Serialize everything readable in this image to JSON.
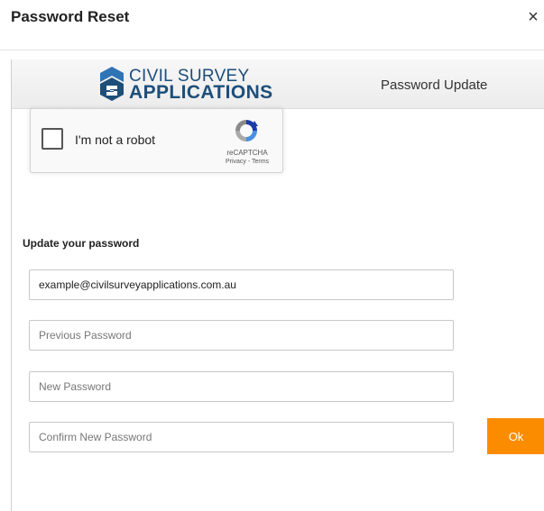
{
  "dialog": {
    "title": "Password Reset",
    "close_label": "×"
  },
  "banner": {
    "logo_line1": "CIVIL SURVEY",
    "logo_line2": "APPLICATIONS",
    "title": "Password Update"
  },
  "recaptcha": {
    "label": "I'm not a robot",
    "brand": "reCAPTCHA",
    "links": "Privacy - Terms",
    "checked": false
  },
  "form": {
    "heading": "Update your password",
    "email_value": "example@civilsurveyapplications.com.au",
    "previous_password_placeholder": "Previous Password",
    "new_password_placeholder": "New Password",
    "confirm_password_placeholder": "Confirm New Password",
    "ok_label": "Ok"
  },
  "colors": {
    "accent_button": "#fb8c00",
    "logo_blue": "#1d4e7a"
  }
}
